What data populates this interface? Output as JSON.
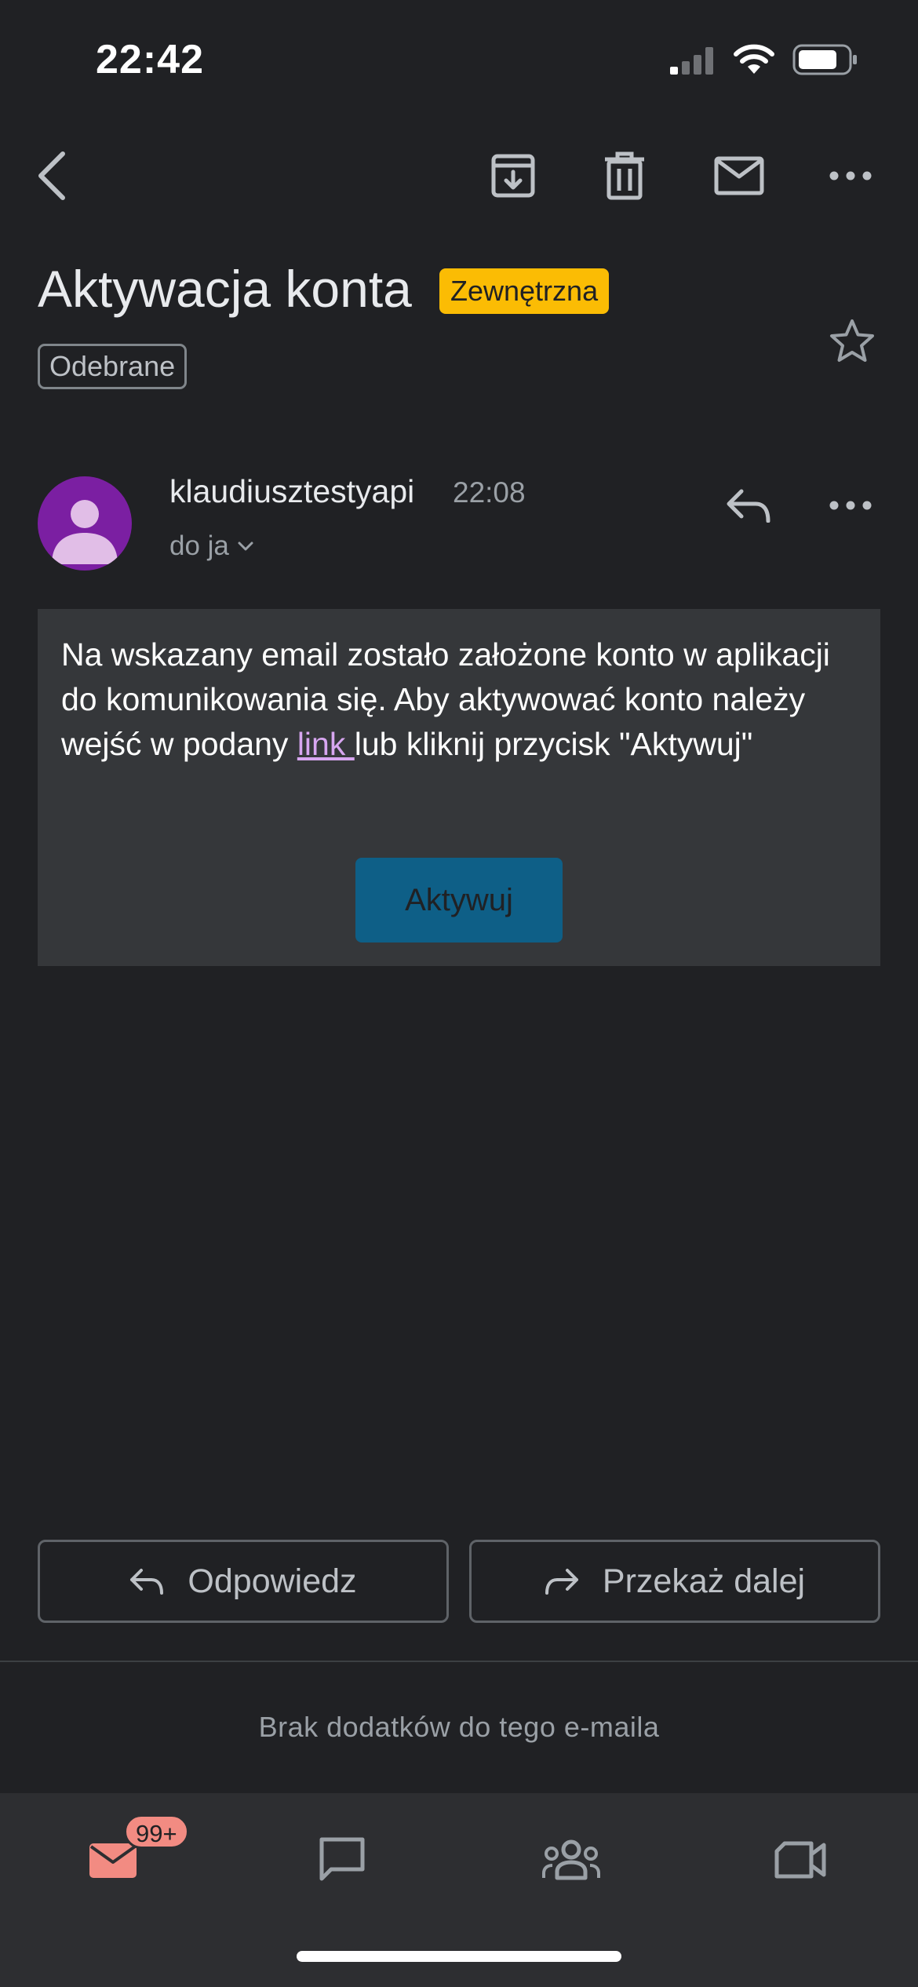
{
  "status_bar": {
    "time": "22:42"
  },
  "email": {
    "subject": "Aktywacja konta",
    "external_badge": "Zewnętrzna",
    "label": "Odebrane",
    "sender": "klaudiusztestyapi",
    "time": "22:08",
    "recipient": "do ja",
    "body_before_link": "Na wskazany email zostało założone konto w aplikacji do komunikowania się. Aby aktywować konto należy wejść w podany ",
    "link_text": "link ",
    "body_after_link": "lub kliknij przycisk \"Aktywuj\"",
    "activate_button": "Aktywuj"
  },
  "actions": {
    "reply": "Odpowiedz",
    "forward": "Przekaż dalej"
  },
  "footer": {
    "no_attachments": "Brak dodatków do tego e-maila"
  },
  "bottom_nav": {
    "mail_badge": "99+"
  },
  "icons": {
    "toolbar": [
      "back-arrow-icon",
      "archive-icon",
      "trash-icon",
      "mark-unread-icon",
      "more-icon"
    ],
    "nav": [
      "mail-icon",
      "chat-icon",
      "spaces-icon",
      "meet-icon"
    ]
  },
  "colors": {
    "background": "#202124",
    "external_badge": "#fbbc04",
    "avatar": "#7b1fa2",
    "message_card": "#35373a",
    "activate_button": "#0e5f87",
    "link": "#d7a6f0",
    "mail_badge": "#f28b82"
  }
}
